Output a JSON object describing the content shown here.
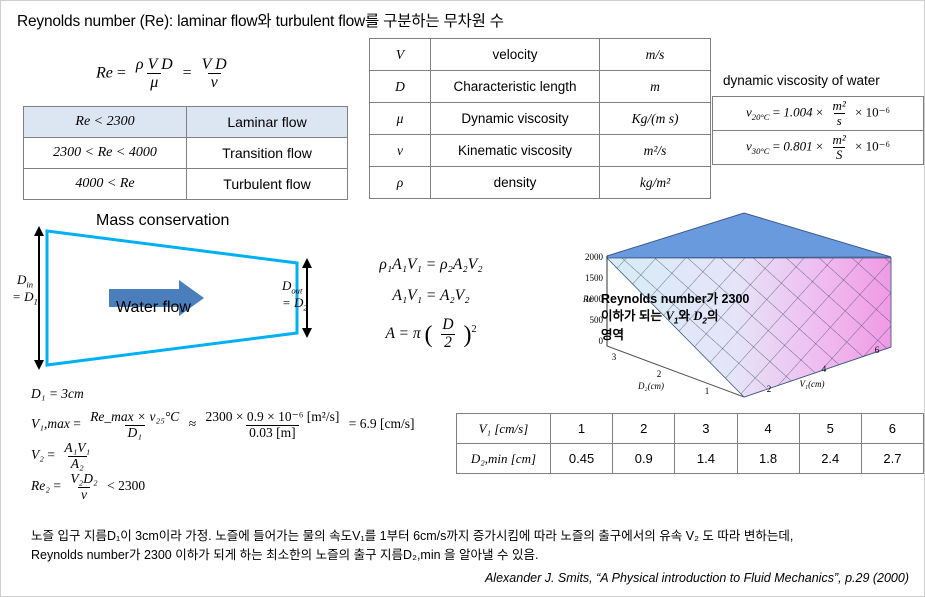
{
  "title": "Reynolds number (Re): laminar flow와 turbulent flow를 구분하는 무차원 수",
  "re_formula": {
    "lhs": "Re",
    "mid_num": "ρ V D",
    "mid_den": "μ",
    "right_num": "V D",
    "right_den": "ν"
  },
  "regime_table": {
    "rows": [
      {
        "range": "Re < 2300",
        "regime": "Laminar flow",
        "header": true
      },
      {
        "range": "2300  < Re < 4000",
        "regime": "Transition flow",
        "header": false
      },
      {
        "range": "4000 < Re",
        "regime": "Turbulent flow",
        "header": false
      }
    ]
  },
  "symbol_table": {
    "rows": [
      {
        "symbol": "V",
        "name": "velocity",
        "unit": "m/s"
      },
      {
        "symbol": "D",
        "name": "Characteristic length",
        "unit": "m"
      },
      {
        "symbol": "μ",
        "name": "Dynamic viscosity",
        "unit": "Kg/(m s)"
      },
      {
        "symbol": "ν",
        "name": "Kinematic viscosity",
        "unit": "m²/s"
      },
      {
        "symbol": "ρ",
        "name": "density",
        "unit": "kg/m²"
      }
    ]
  },
  "viscosity": {
    "title": "dynamic viscosity of water",
    "rows": [
      {
        "sym": "ν",
        "sub": "20°C",
        "value": "1.004",
        "unit_num": "m²",
        "unit_den": "s",
        "exp": "× 10⁻⁶"
      },
      {
        "sym": "ν",
        "sub": "30°C",
        "value": "0.801",
        "unit_num": "m²",
        "unit_den": "S",
        "exp": "× 10⁻⁶"
      }
    ]
  },
  "nozzle": {
    "heading": "Mass conservation",
    "flow_label": "Water flow",
    "inlet_label_line1": "D",
    "inlet_label_sub1": "in",
    "inlet_label_line2": "= D",
    "inlet_label_sub2": "1",
    "outlet_label_line1": "D",
    "outlet_label_sub1": "out",
    "outlet_label_line2": "= D",
    "outlet_label_sub2": "2",
    "pipe_color": "#00b0f0",
    "arrow_color": "#4a7ebc"
  },
  "mass_equations": {
    "eq1": "ρ₁A₁V₁ = ρ₂A₂V₂",
    "eq2": "A₁V₁ = A₂V₂",
    "eq3_lhs": "A = π",
    "eq3_num": "D",
    "eq3_den": "2",
    "eq3_pow": "2"
  },
  "derivation": {
    "line1": "D₁ = 3cm",
    "line2_lhs": "V₁,max",
    "line2_num": "Re_max × ν₂₅°C",
    "line2_den": "D₁",
    "line2_approx": "≈",
    "line2_num2": "2300 × 0.9 × 10⁻⁶ [m²/s]",
    "line2_den2": "0.03 [m]",
    "line2_result": "= 6.9 [cm/s]",
    "line3_lhs": "V₂",
    "line3_num": "A₁V₁",
    "line3_den": "A₂",
    "line4_lhs": "Re₂",
    "line4_num": "V₂D₂",
    "line4_den": "ν",
    "line4_cond": "< 2300"
  },
  "results_table": {
    "row1_header": "V₁ [cm/s]",
    "row2_header": "D₂,min [cm]",
    "v1": [
      "1",
      "2",
      "3",
      "4",
      "5",
      "6"
    ],
    "d2min": [
      "0.45",
      "0.9",
      "1.4",
      "1.8",
      "2.4",
      "2.7"
    ]
  },
  "plot_annotation": {
    "line1": "Reynolds number가 2300",
    "line2_a": "이하가  되는 ",
    "line2_v": "V",
    "line2_vsub": "1",
    "line2_b": "와  ",
    "line2_d": "D",
    "line2_dsub": "2",
    "line2_c": "의",
    "line3": "영역"
  },
  "bottom_text": {
    "line1": "노즐 입구 지름D₁이 3cm이라 가정. 노즐에 들어가는 물의 속도V₁를 1부터 6cm/s까지 증가시킴에 따라 노즐의 출구에서의 유속 V₂ 도 따라 변하는데,",
    "line2": "Reynolds number가 2300 이하가 되게 하는 최소한의 노즐의 출구 지름D₂,min 을 알아낼 수 있음."
  },
  "credit": "Alexander J. Smits, “A Physical introduction to Fluid Mechanics”,  p.29 (2000)",
  "chart_data": {
    "type": "surface",
    "title": "",
    "zlabel": "Re",
    "xlabel": "D₂(cm)",
    "ylabel": "V₁(cm)",
    "z_ticks": [
      "0",
      "500",
      "1000",
      "1500",
      "2000"
    ],
    "zlim": [
      0,
      2300
    ],
    "x_ticks": [
      "3",
      "2",
      "1"
    ],
    "xlim": [
      0,
      3
    ],
    "y_ticks": [
      "2",
      "4",
      "6"
    ],
    "ylim": [
      0,
      7
    ],
    "grid": true,
    "colors": {
      "cap": "#6a9ade",
      "low": "#d6edf5",
      "high": "#f0a8e8"
    },
    "note": "Re = V1*D1^2/(D2*nu) surface clipped at Re = 2300"
  }
}
